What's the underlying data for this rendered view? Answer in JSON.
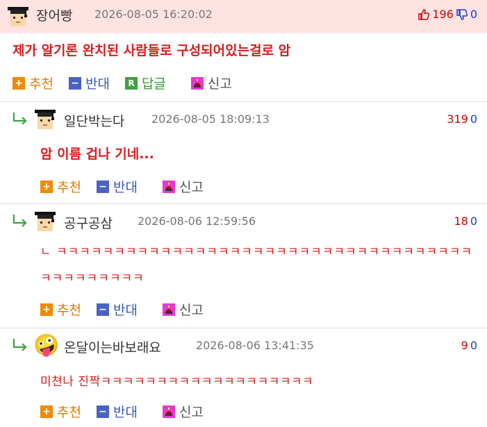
{
  "actions": {
    "recommend": "추천",
    "oppose": "반대",
    "reply": "답글",
    "report": "신고"
  },
  "comments": [
    {
      "nickname": "장어빵",
      "date": "2026-08-05 16:20:02",
      "upvotes": "196",
      "downvotes": "0",
      "text": "제가 알기론 완치된 사람들로 구성되어있는걸로 암",
      "avatar": "graduate-avatar-icon"
    },
    {
      "nickname": "일단박는다",
      "date": "2026-08-05 18:09:13",
      "upvotes": "319",
      "downvotes": "0",
      "text": "암 이름 겁나 기네...",
      "avatar": "graduate-avatar-icon"
    },
    {
      "nickname": "공구공삼",
      "date": "2026-08-06 12:59:56",
      "upvotes": "18",
      "downvotes": "0",
      "text": "ㄴ ㅋㅋㅋㅋㅋㅋㅋㅋㅋㅋㅋㅋㅋㅋㅋㅋㅋㅋㅋㅋㅋㅋㅋㅋㅋㅋㅋㅋㅋㅋㅋㅋㅋㅋㅋㅋㅋㅋㅋㅋㅋㅋㅋㅋㅋ",
      "avatar": "graduate-avatar-icon"
    },
    {
      "nickname": "온달이는바보래요",
      "date": "2026-08-06 13:41:35",
      "upvotes": "9",
      "downvotes": "0",
      "text": "미쳔나 진짝ㅋㅋㅋㅋㅋㅋㅋㅋㅋㅋㅋㅋㅋㅋㅋㅋㅋㅋㅋ",
      "avatar": "silly-face-emoji-icon"
    }
  ],
  "colors": {
    "highlight_bg": "#ffe3e3",
    "text_red": "#d81b1b",
    "up_red": "#d40000",
    "down_blue": "#1a3ec8",
    "recommend_orange": "#f08a00",
    "oppose_blue": "#4a62c4",
    "reply_green": "#3fa23f",
    "report_magenta": "#e23ad1"
  }
}
